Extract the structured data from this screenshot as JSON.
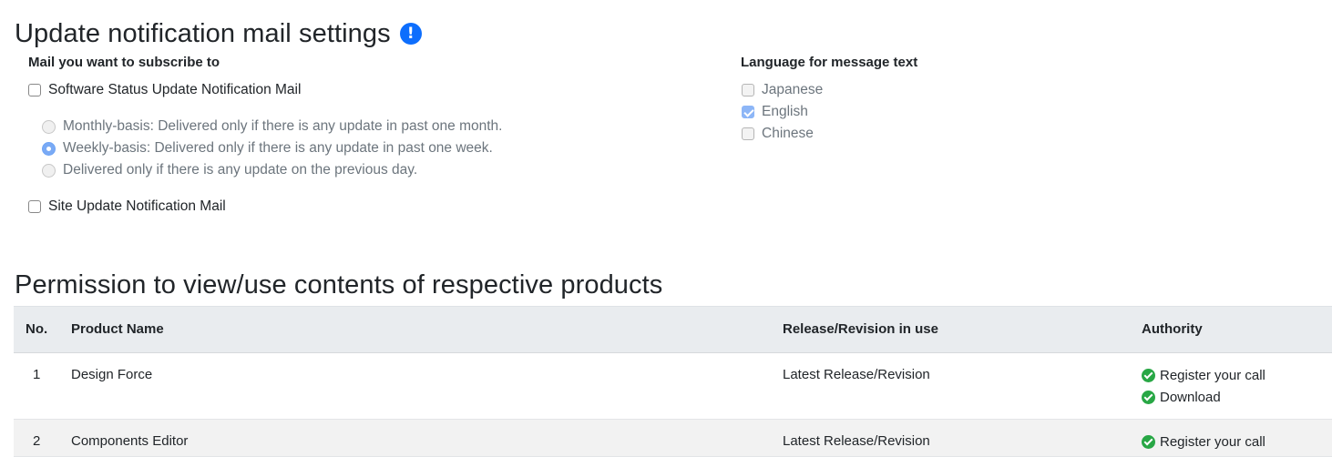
{
  "mail_settings": {
    "title": "Update notification mail settings",
    "info_icon": "info-circle-icon",
    "subscribe_label": "Mail you want to subscribe to",
    "software_status_label": "Software Status Update Notification Mail",
    "software_status_checked": false,
    "frequency_options": [
      {
        "label": "Monthly-basis: Delivered only if there is any update in past one month.",
        "selected": false
      },
      {
        "label": "Weekly-basis: Delivered only if there is any update in past one week.",
        "selected": true
      },
      {
        "label": "Delivered only if there is any update on the previous day.",
        "selected": false
      }
    ],
    "site_update_label": "Site Update Notification Mail",
    "site_update_checked": false,
    "language_label": "Language for message text",
    "languages": [
      {
        "label": "Japanese",
        "checked": false
      },
      {
        "label": "English",
        "checked": true
      },
      {
        "label": "Chinese",
        "checked": false
      }
    ]
  },
  "permissions": {
    "title": "Permission to view/use contents of respective products",
    "headers": {
      "no": "No.",
      "product": "Product Name",
      "release": "Release/Revision in use",
      "authority": "Authority"
    },
    "rows": [
      {
        "no": "1",
        "product": "Design Force",
        "release": "Latest Release/Revision",
        "authority": [
          "Register your call",
          "Download"
        ]
      },
      {
        "no": "2",
        "product": "Components Editor",
        "release": "Latest Release/Revision",
        "authority": [
          "Register your call"
        ]
      }
    ],
    "authority_icon": "check-circle-icon",
    "colors": {
      "header_bg": "#e9ecef",
      "check": "#28a745",
      "accent": "#0d6efd"
    }
  }
}
